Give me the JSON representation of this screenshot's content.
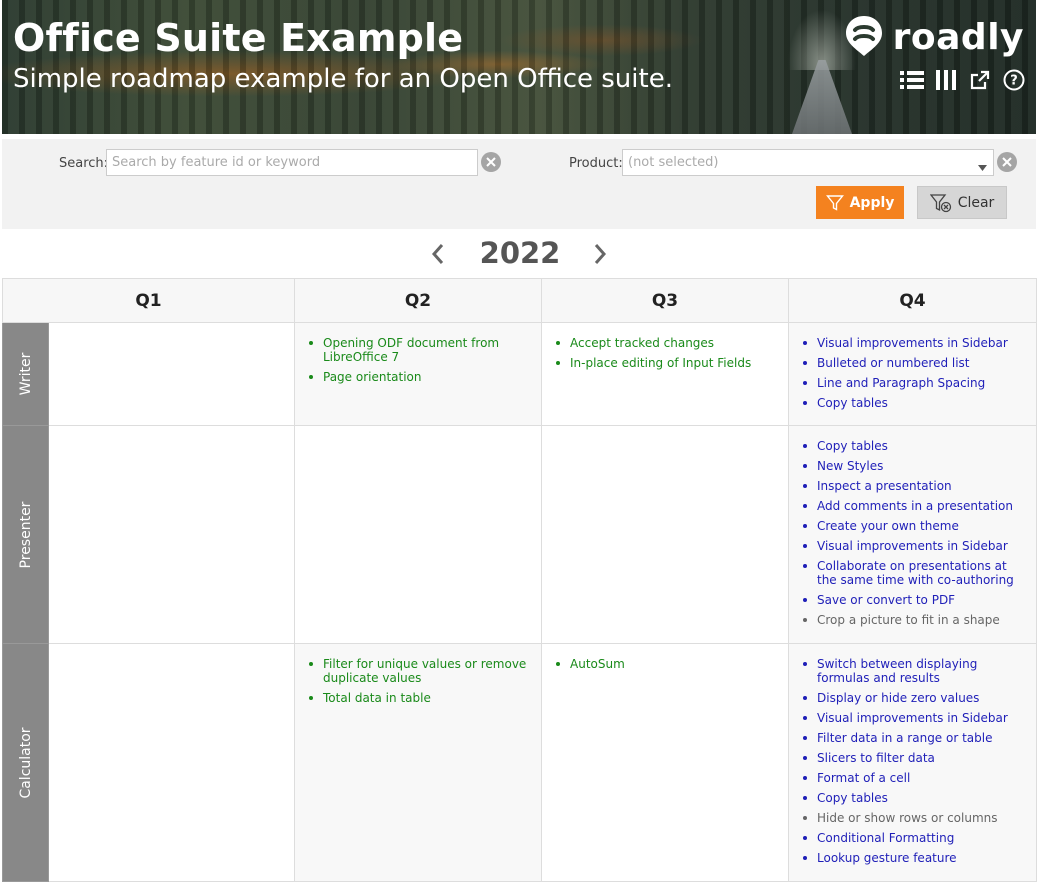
{
  "header": {
    "title": "Office Suite Example",
    "subtitle": "Simple roadmap example for an Open Office suite.",
    "logo_text": "roadly",
    "icons": [
      "list-view-icon",
      "columns-view-icon",
      "external-link-icon",
      "help-icon"
    ]
  },
  "filters": {
    "search_label": "Search:",
    "search_placeholder": "Search by feature id or keyword",
    "product_label": "Product:",
    "product_value": "(not selected)",
    "apply_label": "Apply",
    "clear_label": "Clear"
  },
  "colors": {
    "accent": "#f4821f",
    "in_progress": "#1a8a1a",
    "planned": "#1f1fb8",
    "backlog": "#666666",
    "row_header": "#888888"
  },
  "year": "2022",
  "quarters": [
    "Q1",
    "Q2",
    "Q3",
    "Q4"
  ],
  "rows": [
    {
      "product": "Writer",
      "q1": [],
      "q2": [
        {
          "text": "Opening ODF document from LibreOffice 7",
          "status": "green"
        },
        {
          "text": "Page orientation",
          "status": "green"
        }
      ],
      "q3": [
        {
          "text": "Accept tracked changes",
          "status": "green"
        },
        {
          "text": "In-place editing of Input Fields",
          "status": "green"
        }
      ],
      "q4": [
        {
          "text": "Visual improvements in Sidebar",
          "status": "blue"
        },
        {
          "text": "Bulleted or numbered list",
          "status": "blue"
        },
        {
          "text": "Line and Paragraph Spacing",
          "status": "blue"
        },
        {
          "text": "Copy tables",
          "status": "blue"
        }
      ]
    },
    {
      "product": "Presenter",
      "q1": [],
      "q2": [],
      "q3": [],
      "q4": [
        {
          "text": "Copy tables",
          "status": "blue"
        },
        {
          "text": "New Styles",
          "status": "blue"
        },
        {
          "text": "Inspect a presentation",
          "status": "blue"
        },
        {
          "text": "Add comments in a presentation",
          "status": "blue"
        },
        {
          "text": "Create your own theme",
          "status": "blue"
        },
        {
          "text": "Visual improvements in Sidebar",
          "status": "blue"
        },
        {
          "text": "Collaborate on presentations at the same time with co-authoring",
          "status": "blue"
        },
        {
          "text": "Save or convert to PDF",
          "status": "blue"
        },
        {
          "text": "Crop a picture to fit in a shape",
          "status": "gray"
        }
      ]
    },
    {
      "product": "Calculator",
      "q1": [],
      "q2": [
        {
          "text": "Filter for unique values or remove duplicate values",
          "status": "green"
        },
        {
          "text": "Total data in table",
          "status": "green"
        }
      ],
      "q3": [
        {
          "text": "AutoSum",
          "status": "green"
        }
      ],
      "q4": [
        {
          "text": "Switch between displaying formulas and results",
          "status": "blue"
        },
        {
          "text": "Display or hide zero values",
          "status": "blue"
        },
        {
          "text": "Visual improvements in Sidebar",
          "status": "blue"
        },
        {
          "text": "Filter data in a range or table",
          "status": "blue"
        },
        {
          "text": "Slicers to filter data",
          "status": "blue"
        },
        {
          "text": "Format of a cell",
          "status": "blue"
        },
        {
          "text": "Copy tables",
          "status": "blue"
        },
        {
          "text": "Hide or show rows or columns",
          "status": "gray"
        },
        {
          "text": "Conditional Formatting",
          "status": "blue"
        },
        {
          "text": "Lookup gesture feature",
          "status": "blue"
        }
      ]
    }
  ]
}
